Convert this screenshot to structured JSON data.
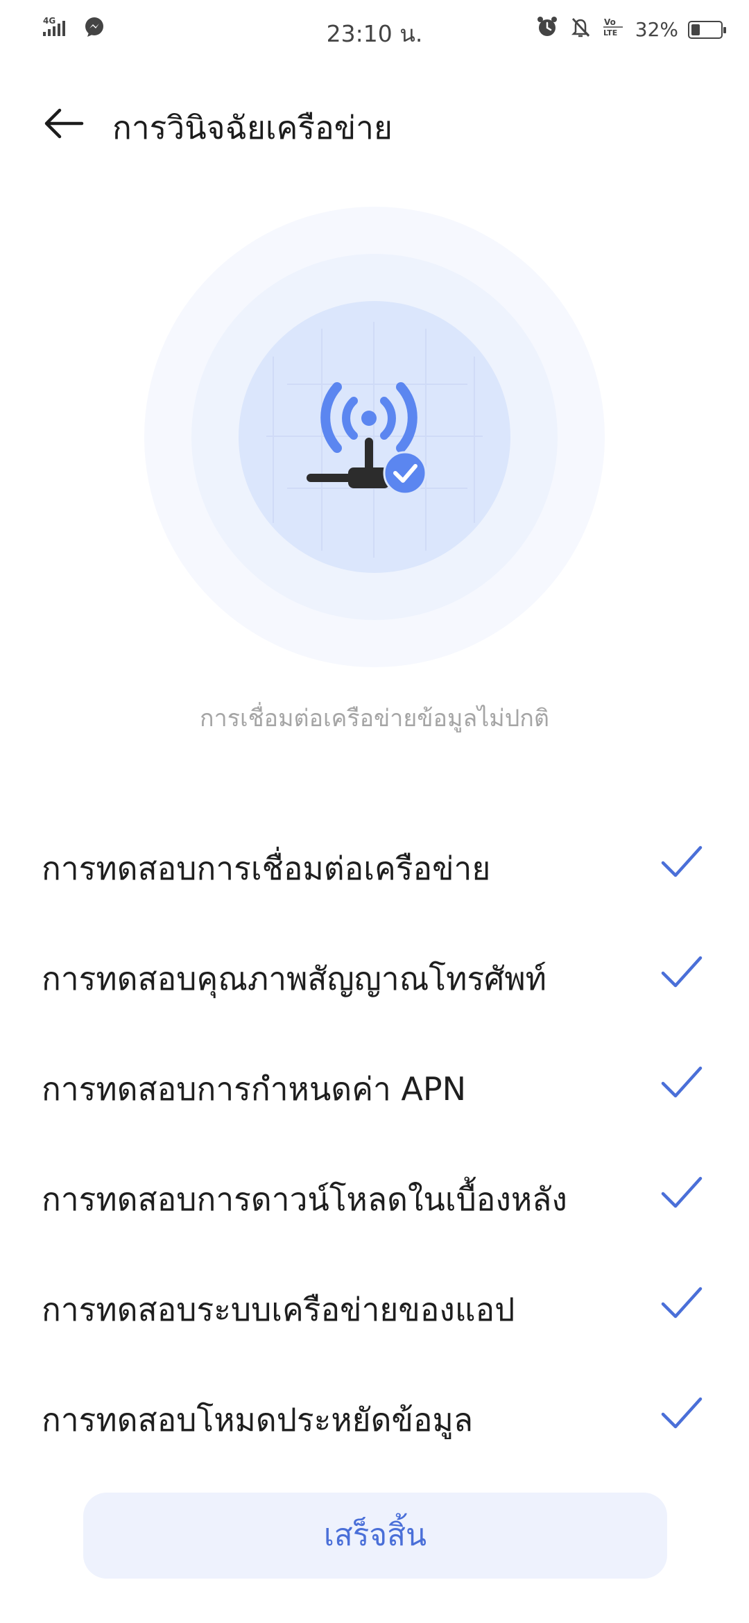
{
  "status_bar": {
    "network": "4G",
    "time": "23:10 น.",
    "battery_percent": "32%",
    "battery_level": 0.32,
    "icons": [
      "signal-icon",
      "messenger-icon",
      "alarm-icon",
      "silent-icon",
      "volte-icon",
      "battery-icon"
    ]
  },
  "header": {
    "title": "การวินิจฉัยเครือข่าย",
    "back_icon": "arrow-left-icon"
  },
  "illustration": {
    "icon": "antenna-check-icon"
  },
  "diagnosis": {
    "status_text": "การเชื่อมต่อเครือข่ายข้อมูลไม่ปกติ"
  },
  "tests": [
    {
      "label": "การทดสอบการเชื่อมต่อเครือข่าย",
      "passed": true
    },
    {
      "label": "การทดสอบคุณภาพสัญญาณโทรศัพท์",
      "passed": true
    },
    {
      "label": "การทดสอบการกำหนดค่า APN",
      "passed": true
    },
    {
      "label": "การทดสอบการดาวน์โหลดในเบื้องหลัง",
      "passed": true
    },
    {
      "label": "การทดสอบระบบเครือข่ายของแอป",
      "passed": true
    },
    {
      "label": "การทดสอบโหมดประหยัดข้อมูล",
      "passed": true
    }
  ],
  "done_button": {
    "label": "เสร็จสิ้น"
  },
  "colors": {
    "accent": "#4a6fd8",
    "check": "#4a6fd8",
    "button_bg": "#eef2fd",
    "status_text": "#a5a5a5"
  }
}
